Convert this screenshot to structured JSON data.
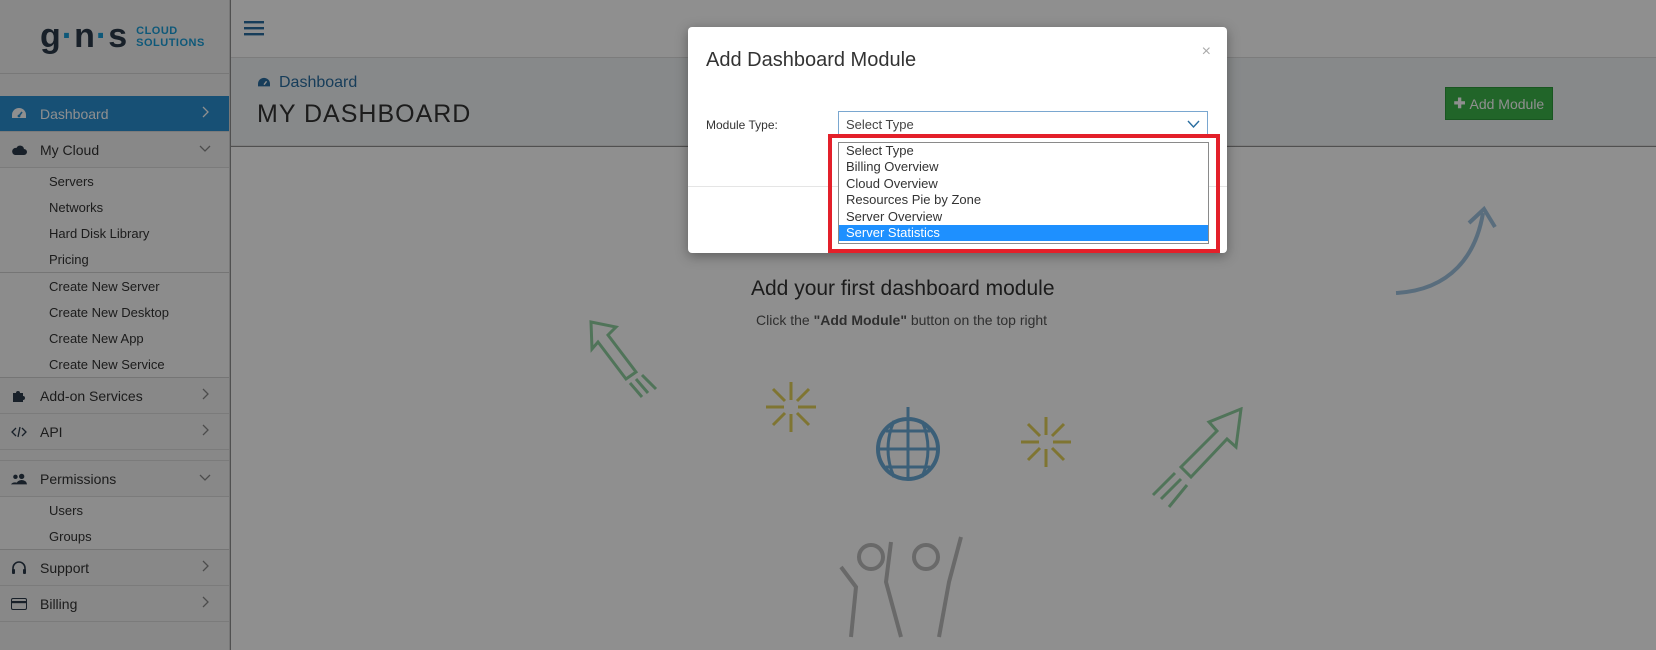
{
  "brand": {
    "logo_mark": "g·n·s",
    "logo_tag_line1": "CLOUD",
    "logo_tag_line2": "SOLUTIONS"
  },
  "sidebar": {
    "items": [
      {
        "label": "Dashboard",
        "icon": "dashboard-icon",
        "active": true
      },
      {
        "label": "My Cloud",
        "icon": "cloud-icon",
        "children": [
          "Servers",
          "Networks",
          "Hard Disk Library",
          "Pricing"
        ],
        "children2": [
          "Create New Server",
          "Create New Desktop",
          "Create New App",
          "Create New Service"
        ]
      },
      {
        "label": "Add-on Services",
        "icon": "puzzle-icon"
      },
      {
        "label": "API",
        "icon": "code-icon"
      },
      {
        "label": "Permissions",
        "icon": "users-icon",
        "children": [
          "Users",
          "Groups"
        ]
      },
      {
        "label": "Support",
        "icon": "headset-icon"
      },
      {
        "label": "Billing",
        "icon": "credit-card-icon"
      }
    ]
  },
  "header": {
    "breadcrumb": "Dashboard",
    "title": "MY DASHBOARD",
    "add_module_label": "Add Module"
  },
  "empty_state": {
    "title": "Add your first dashboard module",
    "hint_pre": "Click the ",
    "hint_bold": "\"Add Module\"",
    "hint_post": " button on the top right"
  },
  "modal": {
    "title": "Add Dashboard Module",
    "close_label": "×",
    "module_type_label": "Module Type:",
    "select_value": "Select Type",
    "options": [
      "Select Type",
      "Billing Overview",
      "Cloud Overview",
      "Resources Pie by Zone",
      "Server Overview",
      "Server Statistics"
    ],
    "highlighted_option": "Server Statistics"
  },
  "colors": {
    "accent": "#2a8fd0",
    "add_button": "#3cb54a",
    "highlight_box": "#e3202a",
    "selected_option": "#1e90ff"
  }
}
